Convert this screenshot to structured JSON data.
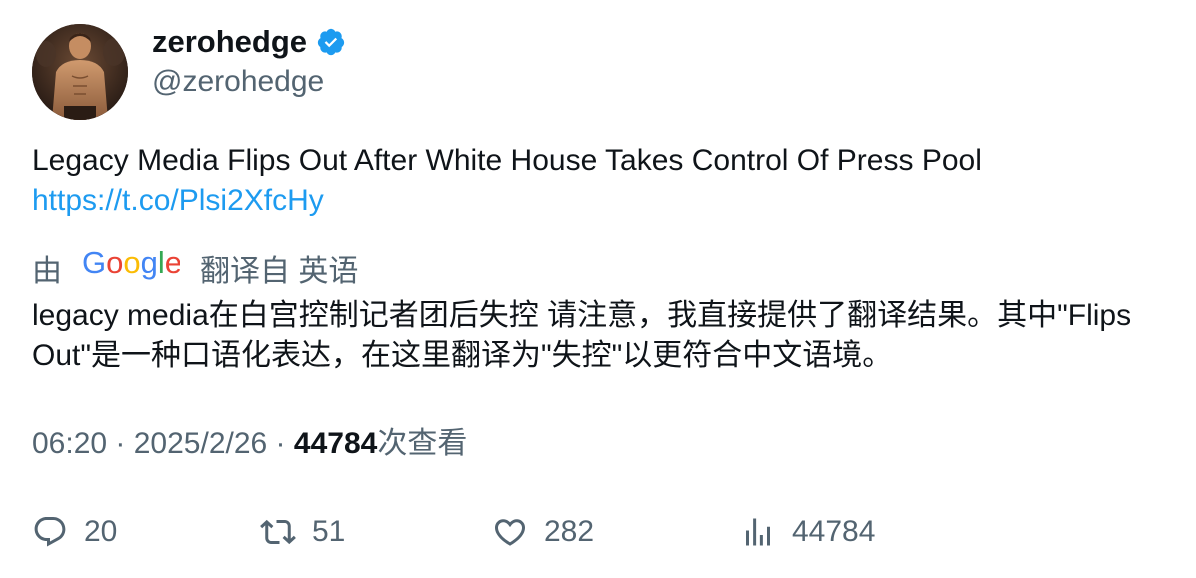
{
  "author": {
    "display_name": "zerohedge",
    "handle": "@zerohedge",
    "verified": true,
    "verified_color": "#1d9bf0"
  },
  "tweet": {
    "text": "Legacy Media Flips Out After White House Takes Control Of Press Pool",
    "link": "https://t.co/Plsi2XfcHy",
    "link_color": "#1d9bf0"
  },
  "translation": {
    "prefix": "由",
    "provider": "Google",
    "suffix": "翻译自 英语",
    "translated_text": "legacy media在白宫控制记者团后失控 请注意，我直接提供了翻译结果。其中\"Flips Out\"是一种口语化表达，在这里翻译为\"失控\"以更符合中文语境。"
  },
  "meta": {
    "time": "06:20",
    "separator": " · ",
    "date": "2025/2/26",
    "views_count": "44784",
    "views_label": "次查看"
  },
  "actions": {
    "replies": "20",
    "retweets": "51",
    "likes": "282",
    "views": "44784"
  },
  "icons": {
    "verified": "verified-badge-icon",
    "reply": "reply-icon",
    "retweet": "retweet-icon",
    "like": "heart-icon",
    "views": "views-chart-icon"
  },
  "colors": {
    "text": "#0f1419",
    "secondary": "#536471",
    "accent": "#1d9bf0"
  }
}
